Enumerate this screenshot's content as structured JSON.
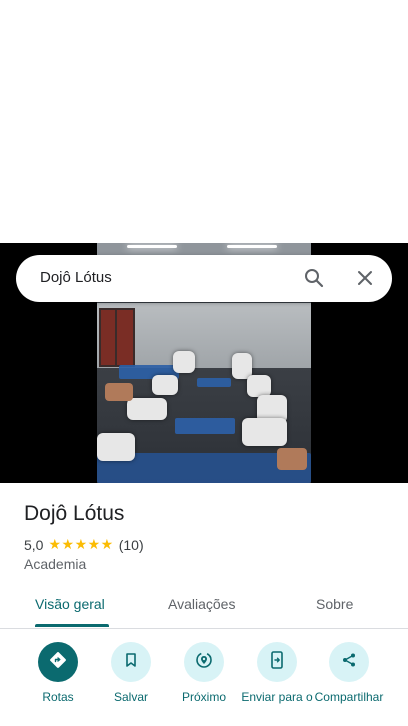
{
  "search": {
    "query": "Dojô Lótus"
  },
  "place": {
    "name": "Dojô Lótus",
    "rating": "5,0",
    "stars": "★★★★★",
    "reviews_count": "(10)",
    "category": "Academia"
  },
  "tabs": [
    {
      "label": "Visão geral",
      "active": true
    },
    {
      "label": "Avaliações",
      "active": false
    },
    {
      "label": "Sobre",
      "active": false
    }
  ],
  "actions": [
    {
      "label": "Rotas",
      "icon": "directions-icon"
    },
    {
      "label": "Salvar",
      "icon": "bookmark-icon"
    },
    {
      "label": "Próximo",
      "icon": "nearby-icon"
    },
    {
      "label": "Enviar para o",
      "icon": "send-to-phone-icon"
    },
    {
      "label": "Compartilhar",
      "icon": "share-icon"
    }
  ],
  "colors": {
    "accent": "#0b6a6f",
    "accent_light": "#d8f3f6",
    "star": "#fbbc04"
  }
}
